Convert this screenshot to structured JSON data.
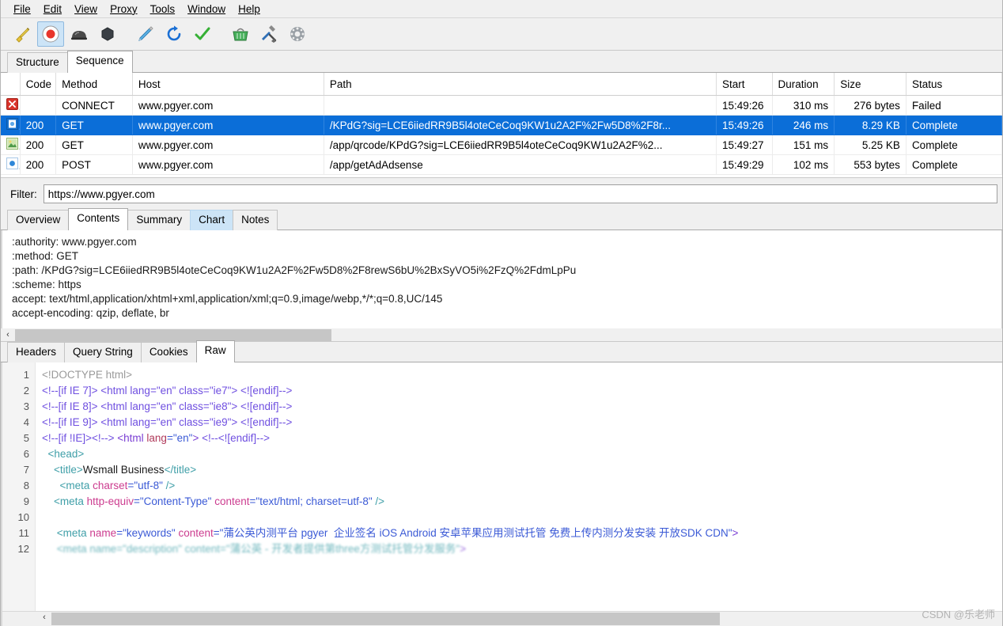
{
  "menu": {
    "items": [
      {
        "label": "File",
        "mnemonic": "F"
      },
      {
        "label": "Edit",
        "mnemonic": "E"
      },
      {
        "label": "View",
        "mnemonic": "V"
      },
      {
        "label": "Proxy",
        "mnemonic": "P"
      },
      {
        "label": "Tools",
        "mnemonic": "T"
      },
      {
        "label": "Window",
        "mnemonic": "W"
      },
      {
        "label": "Help",
        "mnemonic": "H"
      }
    ]
  },
  "toolbar": {
    "buttons": [
      {
        "name": "clear-session-icon",
        "title": "Clear Session"
      },
      {
        "name": "record-icon",
        "title": "Start/Stop Recording",
        "active": true
      },
      {
        "name": "throttle-icon",
        "title": "Start/Stop Throttling"
      },
      {
        "name": "breakpoints-icon",
        "title": "Enable/Disable Breakpoints"
      },
      {
        "name": "compose-icon",
        "title": "Compose"
      },
      {
        "name": "repeat-icon",
        "title": "Repeat"
      },
      {
        "name": "validate-icon",
        "title": "Validate"
      },
      {
        "name": "tools-basket-icon",
        "title": "Tools"
      },
      {
        "name": "settings-wrench-icon",
        "title": "Settings"
      },
      {
        "name": "gear-icon",
        "title": "Preferences"
      }
    ]
  },
  "top_tabs": [
    {
      "label": "Structure",
      "state": "normal"
    },
    {
      "label": "Sequence",
      "state": "selected"
    }
  ],
  "sessions": {
    "columns": [
      "",
      "Code",
      "Method",
      "Host",
      "Path",
      "Start",
      "Duration",
      "Size",
      "Status"
    ],
    "rows": [
      {
        "icon": "error-icon",
        "code": "",
        "method": "CONNECT",
        "host": "www.pgyer.com",
        "path": "",
        "start": "15:49:26",
        "duration": "310 ms",
        "size": "276 bytes",
        "status": "Failed",
        "selected": false
      },
      {
        "icon": "document-icon",
        "code": "200",
        "method": "GET",
        "host": "www.pgyer.com",
        "path": "/KPdG?sig=LCE6iiedRR9B5l4oteCeCoq9KW1u2A2F%2Fw5D8%2F8r...",
        "start": "15:49:26",
        "duration": "246 ms",
        "size": "8.29 KB",
        "status": "Complete",
        "selected": true
      },
      {
        "icon": "image-icon",
        "code": "200",
        "method": "GET",
        "host": "www.pgyer.com",
        "path": "/app/qrcode/KPdG?sig=LCE6iiedRR9B5l4oteCeCoq9KW1u2A2F%2...",
        "start": "15:49:27",
        "duration": "151 ms",
        "size": "5.25 KB",
        "status": "Complete",
        "selected": false
      },
      {
        "icon": "data-icon",
        "code": "200",
        "method": "POST",
        "host": "www.pgyer.com",
        "path": "/app/getAdAdsense",
        "start": "15:49:29",
        "duration": "102 ms",
        "size": "553 bytes",
        "status": "Complete",
        "selected": false
      }
    ]
  },
  "filter": {
    "label": "Filter:",
    "value": "https://www.pgyer.com",
    "placeholder": ""
  },
  "mid_tabs": [
    {
      "label": "Overview",
      "state": "normal"
    },
    {
      "label": "Contents",
      "state": "selected"
    },
    {
      "label": "Summary",
      "state": "normal"
    },
    {
      "label": "Chart",
      "state": "hovered"
    },
    {
      "label": "Notes",
      "state": "normal"
    }
  ],
  "headers": {
    "lines": [
      ":authority: www.pgyer.com",
      ":method: GET",
      ":path: /KPdG?sig=LCE6iiedRR9B5l4oteCeCoq9KW1u2A2F%2Fw5D8%2F8rewS6bU%2BxSyVO5i%2FzQ%2FdmLpPu",
      ":scheme: https",
      "accept: text/html,application/xhtml+xml,application/xml;q=0.9,image/webp,*/*;q=0.8,UC/145",
      "accept-encoding: qzip, deflate, br"
    ],
    "scroll_left_arrow": "‹"
  },
  "bottom_tabs": [
    {
      "label": "Headers",
      "state": "normal"
    },
    {
      "label": "Query String",
      "state": "normal"
    },
    {
      "label": "Cookies",
      "state": "normal"
    },
    {
      "label": "Raw",
      "state": "selected"
    }
  ],
  "code": {
    "line_numbers": [
      "1",
      "2",
      "3",
      "4",
      "5",
      "6",
      "7",
      "8",
      "9",
      "10",
      "11",
      "12"
    ],
    "scroll_left_arrow": "‹",
    "lines": [
      [
        {
          "t": "doctype",
          "v": "<!DOCTYPE html>"
        }
      ],
      [
        {
          "t": "cond",
          "v": "<!--[if IE 7]> <html lang=\"en\" class=\"ie7\"> <![endif]-->"
        }
      ],
      [
        {
          "t": "cond",
          "v": "<!--[if IE 8]> <html lang=\"en\" class=\"ie8\"> <![endif]-->"
        }
      ],
      [
        {
          "t": "cond",
          "v": "<!--[if IE 9]> <html lang=\"en\" class=\"ie9\"> <![endif]-->"
        }
      ],
      [
        {
          "t": "cond",
          "v": "<!--[if !IE]><!--> "
        },
        {
          "t": "tagv",
          "v": "<html "
        },
        {
          "t": "attr2",
          "v": "lang"
        },
        {
          "t": "val",
          "v": "=\"en\""
        },
        {
          "t": "tagv",
          "v": "> "
        },
        {
          "t": "cond",
          "v": "<!--<![endif]-->"
        }
      ],
      [
        {
          "t": "tag",
          "v": "  <head>"
        }
      ],
      [
        {
          "t": "tag",
          "v": "    <title>"
        },
        {
          "t": "text",
          "v": "Wsmall Business"
        },
        {
          "t": "tag",
          "v": "</title>"
        }
      ],
      [
        {
          "t": "tag",
          "v": "      <meta "
        },
        {
          "t": "attr",
          "v": "charset"
        },
        {
          "t": "val",
          "v": "=\"utf-8\""
        },
        {
          "t": "tag",
          "v": " />"
        }
      ],
      [
        {
          "t": "tag",
          "v": "    <meta "
        },
        {
          "t": "attr",
          "v": "http-equiv"
        },
        {
          "t": "val",
          "v": "=\"Content-Type\""
        },
        {
          "t": "attr",
          "v": " content"
        },
        {
          "t": "val",
          "v": "=\"text/html; charset=utf-8\""
        },
        {
          "t": "tag",
          "v": " />"
        }
      ],
      [],
      [
        {
          "t": "tag",
          "v": "     <meta "
        },
        {
          "t": "attr",
          "v": "name"
        },
        {
          "t": "val",
          "v": "=\"keywords\""
        },
        {
          "t": "attr",
          "v": " content"
        },
        {
          "t": "val",
          "v": "=\"蒲公英内测平台 pgyer  企业签名 iOS Android 安卓苹果应用测试托管 免费上传内测分发安装 开放SDK CDN\""
        },
        {
          "t": "tagv",
          "v": ">"
        }
      ],
      [
        {
          "t": "tag",
          "v": "     <meta name=\"description\" content=\"蒲公英 - 开发者提供第three方测试托管分发服务\""
        },
        {
          "t": "tagv",
          "v": ">"
        }
      ]
    ]
  },
  "watermark": "CSDN @乐老师",
  "colors": {
    "selection_blue": "#0b6ed8",
    "tab_hover_blue": "#cce4f7",
    "window_gray": "#f0f0f0",
    "error_red": "#d9342b",
    "record_red": "#e8352b"
  }
}
